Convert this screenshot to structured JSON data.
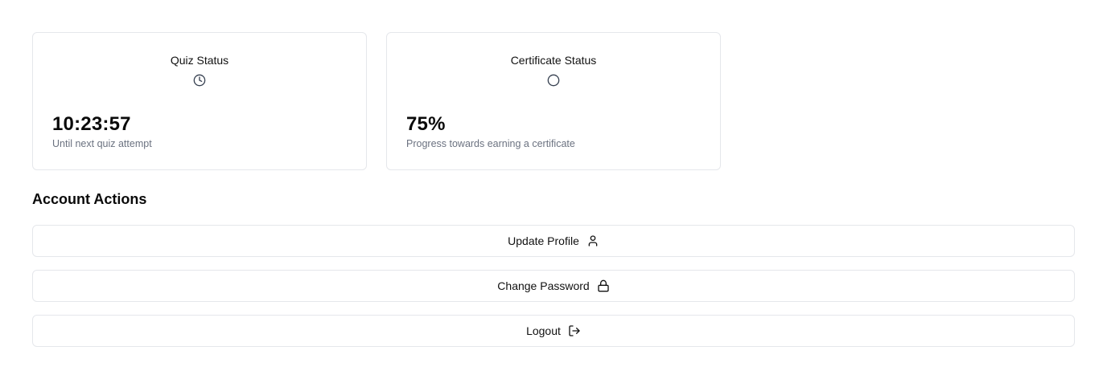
{
  "quiz_status": {
    "title": "Quiz Status",
    "icon": "clock-icon",
    "value": "10:23:57",
    "caption": "Until next quiz attempt"
  },
  "certificate_status": {
    "title": "Certificate Status",
    "icon": "circle-icon",
    "value": "75%",
    "caption": "Progress towards earning a certificate"
  },
  "account_actions": {
    "title": "Account Actions",
    "buttons": [
      {
        "label": "Update Profile",
        "icon": "user-icon"
      },
      {
        "label": "Change Password",
        "icon": "lock-icon"
      },
      {
        "label": "Logout",
        "icon": "logout-icon"
      }
    ]
  },
  "colors": {
    "border": "#e5e7eb",
    "text": "#111111",
    "muted": "#6b7280",
    "background": "#ffffff"
  }
}
